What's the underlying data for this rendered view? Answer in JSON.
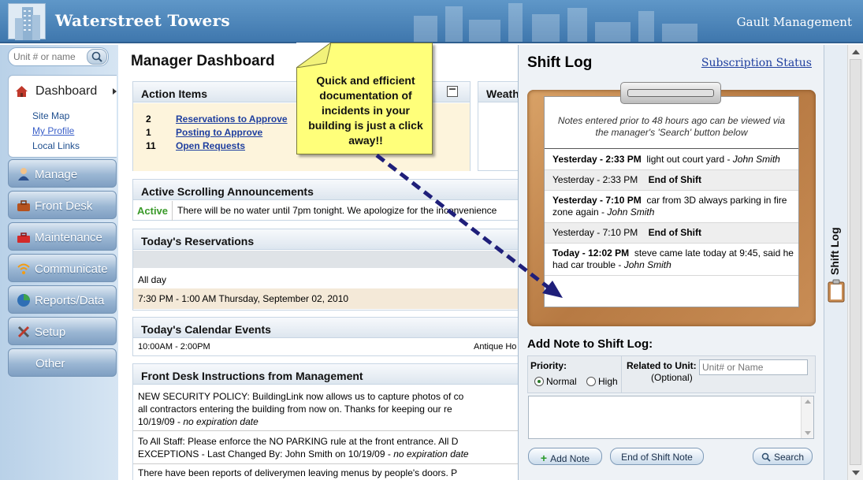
{
  "header": {
    "brand": "Waterstreet Towers",
    "company": "Gault Management"
  },
  "sidebar": {
    "search_placeholder": "Unit # or name",
    "dashboard": {
      "label": "Dashboard",
      "sub_items": [
        "Site Map",
        "My Profile",
        "Local Links"
      ]
    },
    "nav": [
      {
        "label": "Manage",
        "icon": "person-icon"
      },
      {
        "label": "Front Desk",
        "icon": "briefcase-icon"
      },
      {
        "label": "Maintenance",
        "icon": "toolbox-icon"
      },
      {
        "label": "Communicate",
        "icon": "wifi-icon"
      },
      {
        "label": "Reports/Data",
        "icon": "pie-chart-icon"
      },
      {
        "label": "Setup",
        "icon": "tools-icon"
      },
      {
        "label": "Other",
        "icon": ""
      }
    ]
  },
  "main": {
    "title": "Manager Dashboard",
    "action_items": {
      "title": "Action Items",
      "rows": [
        {
          "count": "2",
          "label": "Reservations to Approve"
        },
        {
          "count": "1",
          "label": "Posting to Approve"
        },
        {
          "count": "11",
          "label": "Open Requests"
        }
      ]
    },
    "weather_title": "Weath",
    "announcements": {
      "title": "Active Scrolling Announcements",
      "status": "Active",
      "text": "There will be no water until 7pm tonight. We apologize for the inconvenience"
    },
    "reservations": {
      "title": "Today's Reservations",
      "rows": [
        "All day",
        "7:30 PM - 1:00 AM Thursday, September 02, 2010"
      ]
    },
    "calendar": {
      "title": "Today's Calendar Events",
      "time": "10:00AM - 2:00PM",
      "event": "Antique Ho"
    },
    "instructions": {
      "title": "Front Desk Instructions from Management",
      "items": [
        {
          "text": "NEW SECURITY POLICY: BuildingLink now allows us to capture photos of co",
          "text2": "all contractors entering the building from now on. Thanks for keeping our re",
          "meta": "10/19/09 - ",
          "exp": "no expiration date"
        },
        {
          "text": "To All Staff: Please enforce the NO PARKING rule at the front entrance. All D",
          "text2": "EXCEPTIONS",
          "meta": " - Last Changed By: John Smith on 10/19/09 - ",
          "exp": "no expiration date"
        },
        {
          "text": "There have been reports of deliverymen leaving menus by people's doors. P"
        }
      ]
    }
  },
  "callout": {
    "text": "Quick and efficient documentation of incidents in your building is just a click away!!"
  },
  "shift_log": {
    "title": "Shift Log",
    "subscription_link": "Subscription Status",
    "note": "Notes entered prior to 48 hours ago can be viewed via the manager's 'Search' button below",
    "entries": [
      {
        "when": "Yesterday - 2:33 PM",
        "text": "light out court yard - ",
        "author": "John Smith",
        "end": false
      },
      {
        "when": "Yesterday - 2:33 PM",
        "text": "End of Shift",
        "author": "",
        "end": true
      },
      {
        "when": "Yesterday - 7:10 PM",
        "text": "car from 3D always parking in fire zone again - ",
        "author": "John Smith",
        "end": false
      },
      {
        "when": "Yesterday - 7:10 PM",
        "text": "End of Shift",
        "author": "",
        "end": true
      },
      {
        "when": "Today - 12:02 PM",
        "text": "steve came late today at 9:45, said he had car trouble - ",
        "author": "John Smith",
        "end": false
      }
    ],
    "add_note_title": "Add Note to Shift Log:",
    "priority_label": "Priority:",
    "priority_options": [
      "Normal",
      "High"
    ],
    "related_label": "Related to Unit:",
    "optional_label": "(Optional)",
    "unit_placeholder": "Unit# or Name",
    "add_note_button": "Add Note",
    "end_shift_button": "End of Shift Note",
    "search_button": "Search",
    "tab_label": "Shift Log"
  }
}
